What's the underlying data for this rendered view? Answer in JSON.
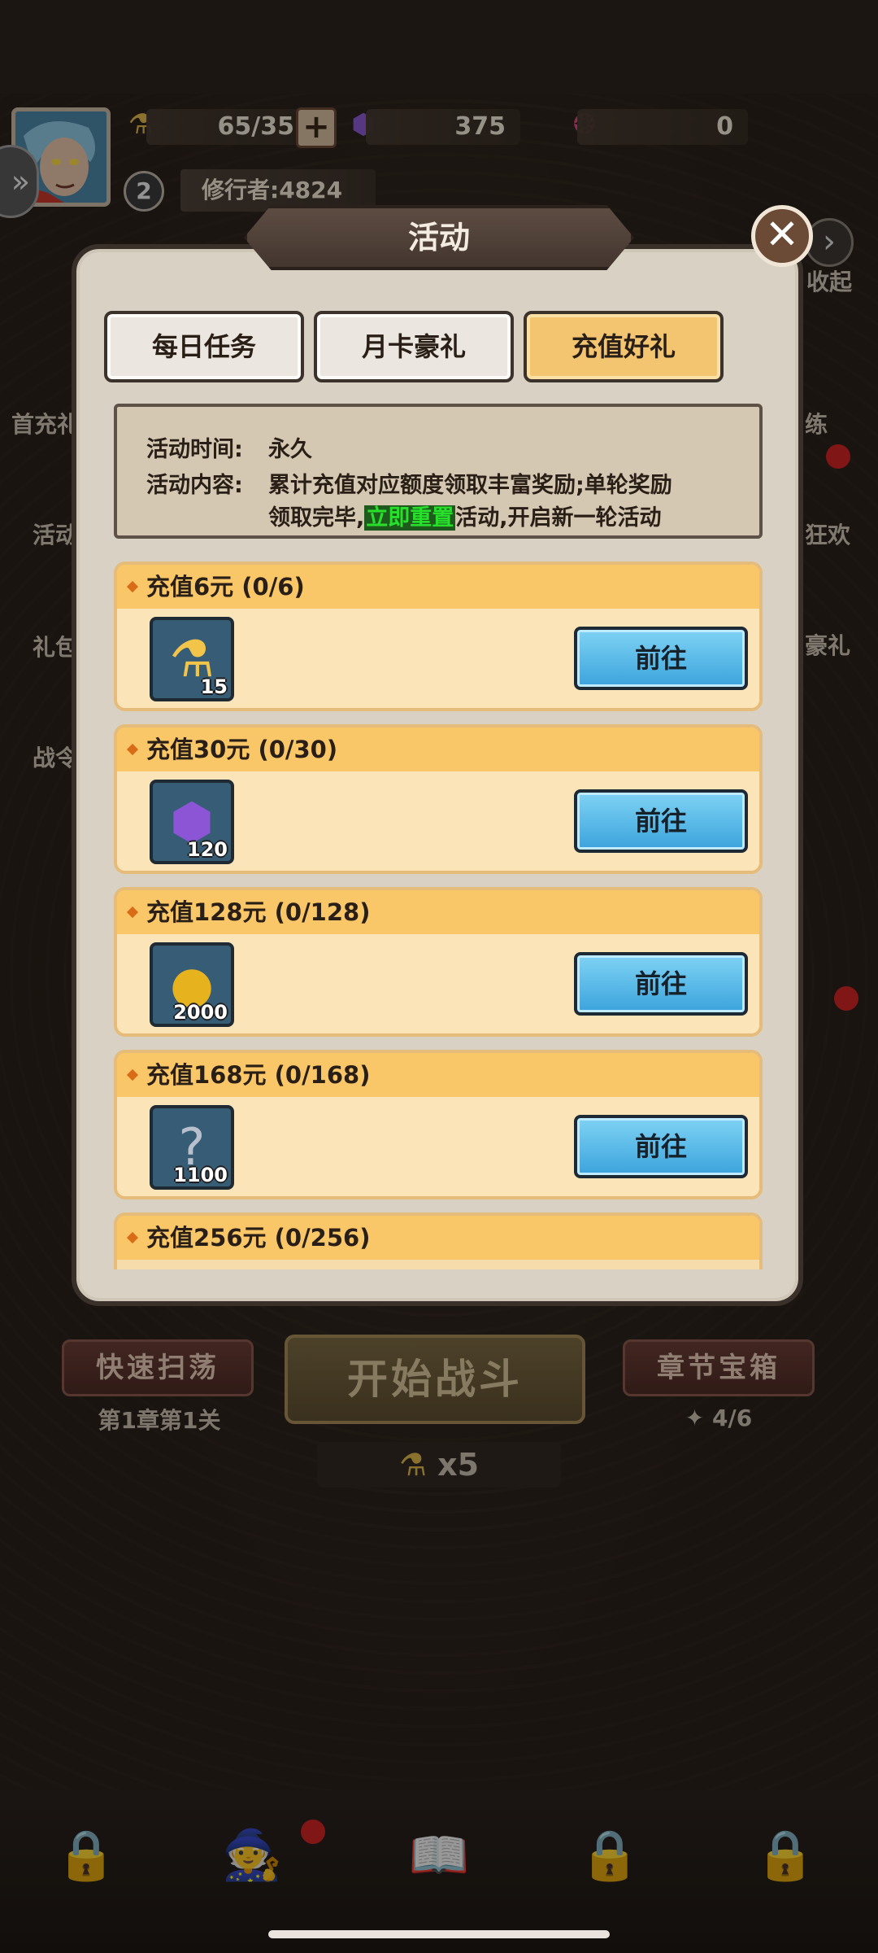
{
  "hud": {
    "stamina": "65/35",
    "gems": "375",
    "tokens": "0",
    "level": "2",
    "player_name": "修行者:4824",
    "collapse_label": "收起"
  },
  "side_menu": {
    "left": [
      "首充礼",
      "活动",
      "礼包",
      "战令"
    ],
    "right": [
      "练",
      "狂欢",
      "豪礼"
    ]
  },
  "modal": {
    "title": "活动",
    "tabs": [
      {
        "label": "每日任务",
        "active": false
      },
      {
        "label": "月卡豪礼",
        "active": false
      },
      {
        "label": "充值好礼",
        "active": true
      }
    ],
    "info": {
      "time_key": "活动时间:",
      "time_value": "永久",
      "content_key": "活动内容:",
      "content_line1": "累计充值对应额度领取丰富奖励;单轮奖励",
      "content_line2_pre": "领取完毕,",
      "content_highlight": "立即重置",
      "content_line2_post": "活动,开启新一轮活动"
    },
    "rows": [
      {
        "title": "充值6元 (0/6)",
        "item_icon": "potion-icon",
        "item_count": "15",
        "button": "前往"
      },
      {
        "title": "充值30元 (0/30)",
        "item_icon": "purple-gem-icon",
        "item_count": "120",
        "button": "前往"
      },
      {
        "title": "充值128元 (0/128)",
        "item_icon": "gold-coin-icon",
        "item_count": "2000",
        "button": "前往"
      },
      {
        "title": "充值168元 (0/168)",
        "item_icon": "mystery-scroll-icon",
        "item_count": "1100",
        "button": "前往"
      },
      {
        "title": "充值256元 (0/256)",
        "item_icon": "",
        "item_count": "",
        "button": ""
      }
    ]
  },
  "game": {
    "sweep_button": "快速扫荡",
    "stage_label": "第1章第1关",
    "start_button": "开始战斗",
    "chest_button": "章节宝箱",
    "chest_progress": "4/6",
    "cost": "x5"
  },
  "colors": {
    "tab_active": "#f3c571",
    "row_header": "#f9c768",
    "go_button": "#3ba3dc",
    "highlight_text": "#28e02c"
  }
}
